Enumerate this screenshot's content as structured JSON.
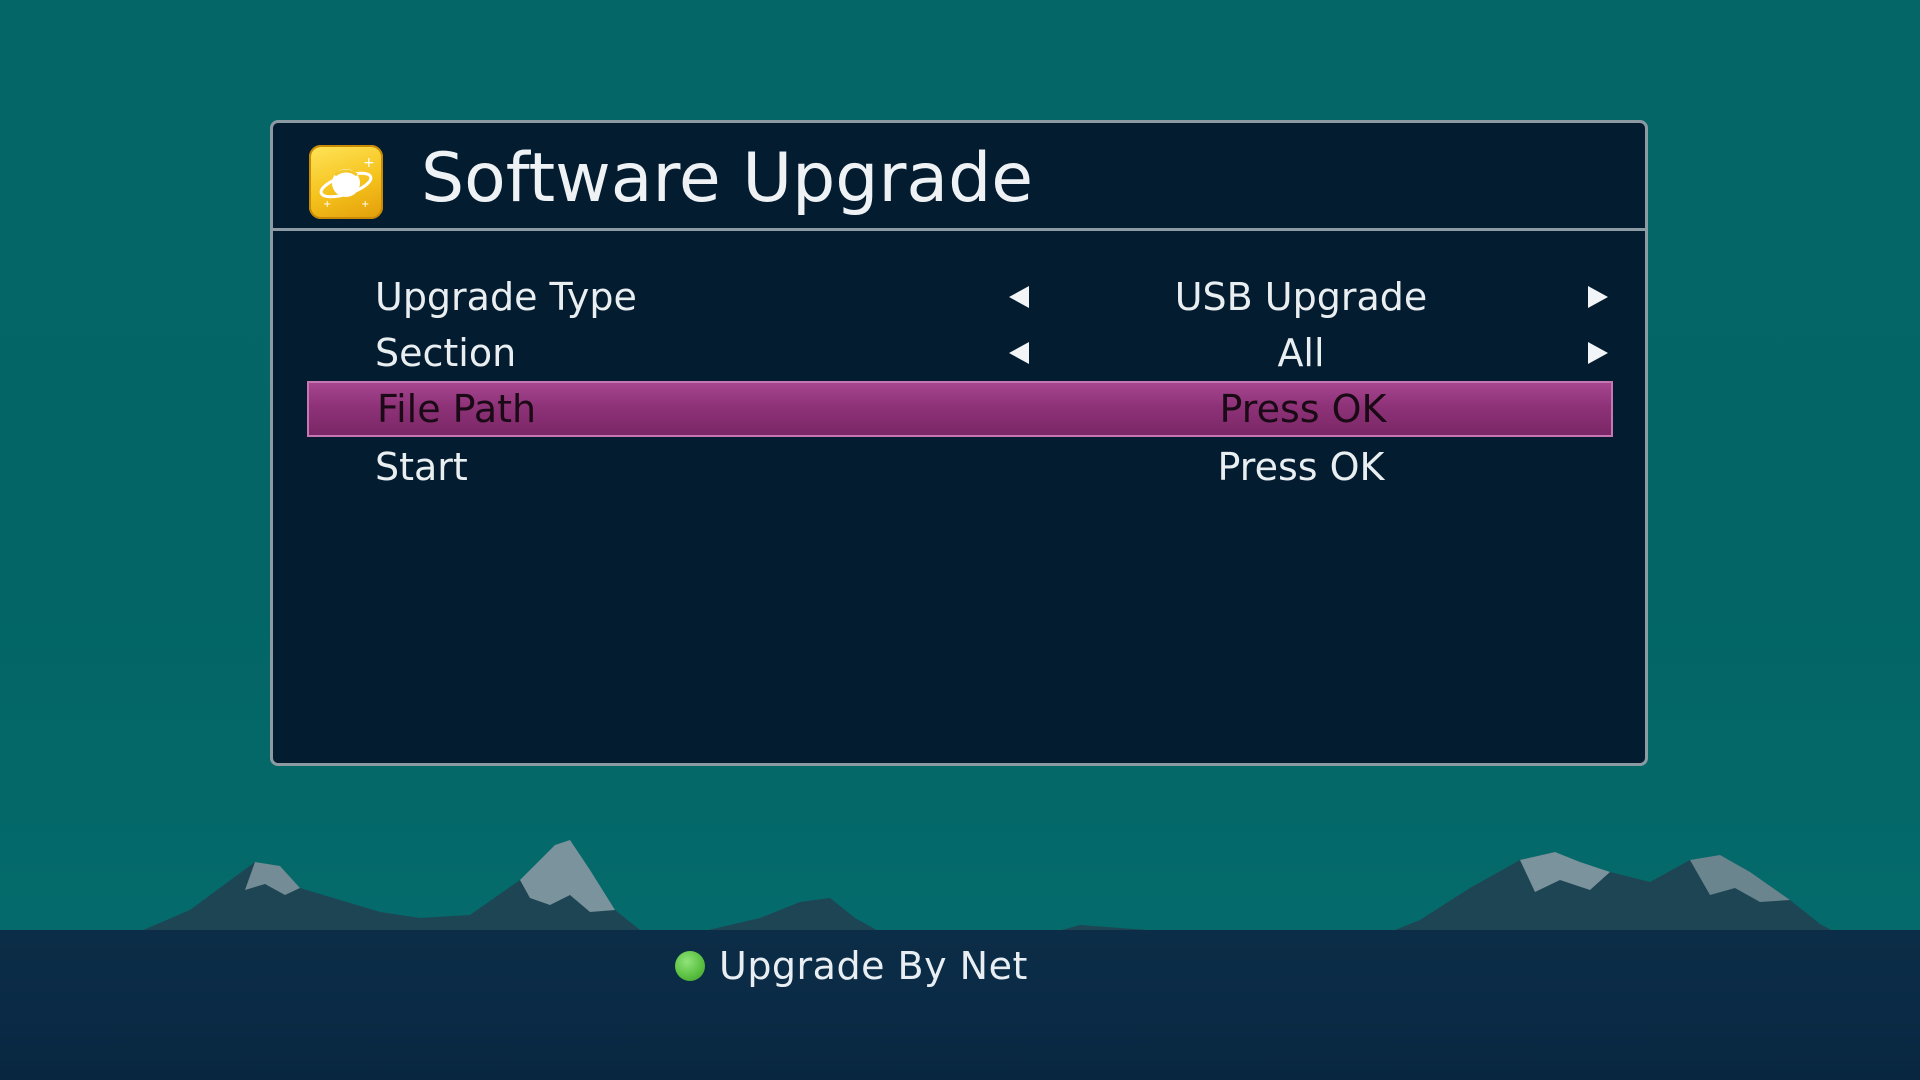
{
  "screen": {
    "title": "Software Upgrade",
    "title_icon": "planet-icon"
  },
  "menu": {
    "rows": [
      {
        "label": "Upgrade Type",
        "value": "USB Upgrade",
        "has_arrows": true,
        "selected": false
      },
      {
        "label": "Section",
        "value": "All",
        "has_arrows": true,
        "selected": false
      },
      {
        "label": "File Path",
        "value": "Press OK",
        "has_arrows": false,
        "selected": true
      },
      {
        "label": "Start",
        "value": "Press OK",
        "has_arrows": false,
        "selected": false
      }
    ]
  },
  "footer": {
    "green_label": "Upgrade By Net",
    "green_key_icon": "green-dot-icon"
  },
  "colors": {
    "background": "#046464",
    "panel": "#041c30",
    "highlight": "#8e3278",
    "green_key": "#5dc243",
    "title_icon": "#f5c21c"
  }
}
